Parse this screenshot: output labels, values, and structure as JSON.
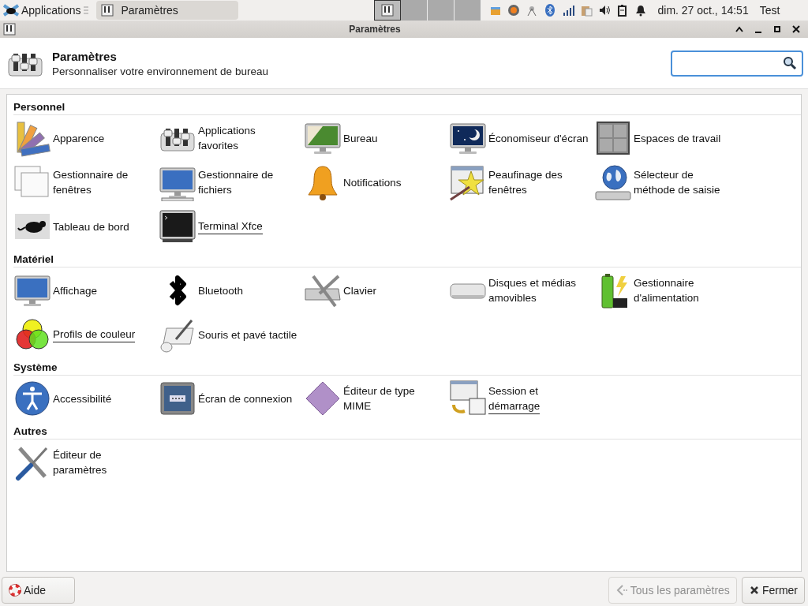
{
  "taskbar": {
    "apps_menu": "Applications",
    "tasks": [
      {
        "label": "Paramètres",
        "selected": true
      }
    ],
    "workspaces": [
      {
        "selected": true
      },
      {
        "selected": false
      },
      {
        "selected": false
      },
      {
        "selected": false
      }
    ],
    "clock": "dim. 27 oct., 14:51",
    "user": "Test"
  },
  "window": {
    "title": "Paramètres"
  },
  "header": {
    "title": "Paramètres",
    "subtitle": "Personnaliser votre environnement de bureau"
  },
  "sections": [
    {
      "title": "Personnel",
      "items": [
        {
          "label": "Apparence",
          "underlined": false
        },
        {
          "label": "Applications\nfavorites",
          "underlined": false
        },
        {
          "label": "Bureau",
          "underlined": false
        },
        {
          "label": "Économiseur d'écran",
          "underlined": false
        },
        {
          "label": "Espaces de travail",
          "underlined": false
        },
        {
          "label": "Gestionnaire de\nfenêtres",
          "underlined": false
        },
        {
          "label": "Gestionnaire de\nfichiers",
          "underlined": false
        },
        {
          "label": "Notifications",
          "underlined": false
        },
        {
          "label": "Peaufinage des\nfenêtres",
          "underlined": false
        },
        {
          "label": "Sélecteur de\nméthode de saisie",
          "underlined": false
        },
        {
          "label": "Tableau de bord",
          "underlined": false
        },
        {
          "label": "Terminal Xfce",
          "underlined": true
        }
      ]
    },
    {
      "title": "Matériel",
      "items": [
        {
          "label": "Affichage",
          "underlined": false
        },
        {
          "label": "Bluetooth",
          "underlined": false
        },
        {
          "label": "Clavier",
          "underlined": false
        },
        {
          "label": "Disques et médias\namovibles",
          "underlined": false
        },
        {
          "label": "Gestionnaire\nd'alimentation",
          "underlined": false
        },
        {
          "label": "Profils de couleur",
          "underlined": true
        },
        {
          "label": "Souris et pavé tactile",
          "underlined": false
        }
      ]
    },
    {
      "title": "Système",
      "items": [
        {
          "label": "Accessibilité",
          "underlined": false
        },
        {
          "label": "Écran de connexion",
          "underlined": false
        },
        {
          "label": "Éditeur de type\nMIME",
          "underlined": false
        },
        {
          "label": "Session et\ndémarrage",
          "underlined": true
        }
      ]
    },
    {
      "title": "Autres",
      "items": [
        {
          "label": "Éditeur de\nparamètres",
          "underlined": false
        }
      ]
    }
  ],
  "buttons": [
    {
      "kind": "help",
      "label": "Aide",
      "disabled": false
    },
    {
      "kind": "back",
      "label": "Tous les paramètres",
      "disabled": true
    },
    {
      "kind": "close",
      "label": "Fermer",
      "disabled": false
    }
  ]
}
